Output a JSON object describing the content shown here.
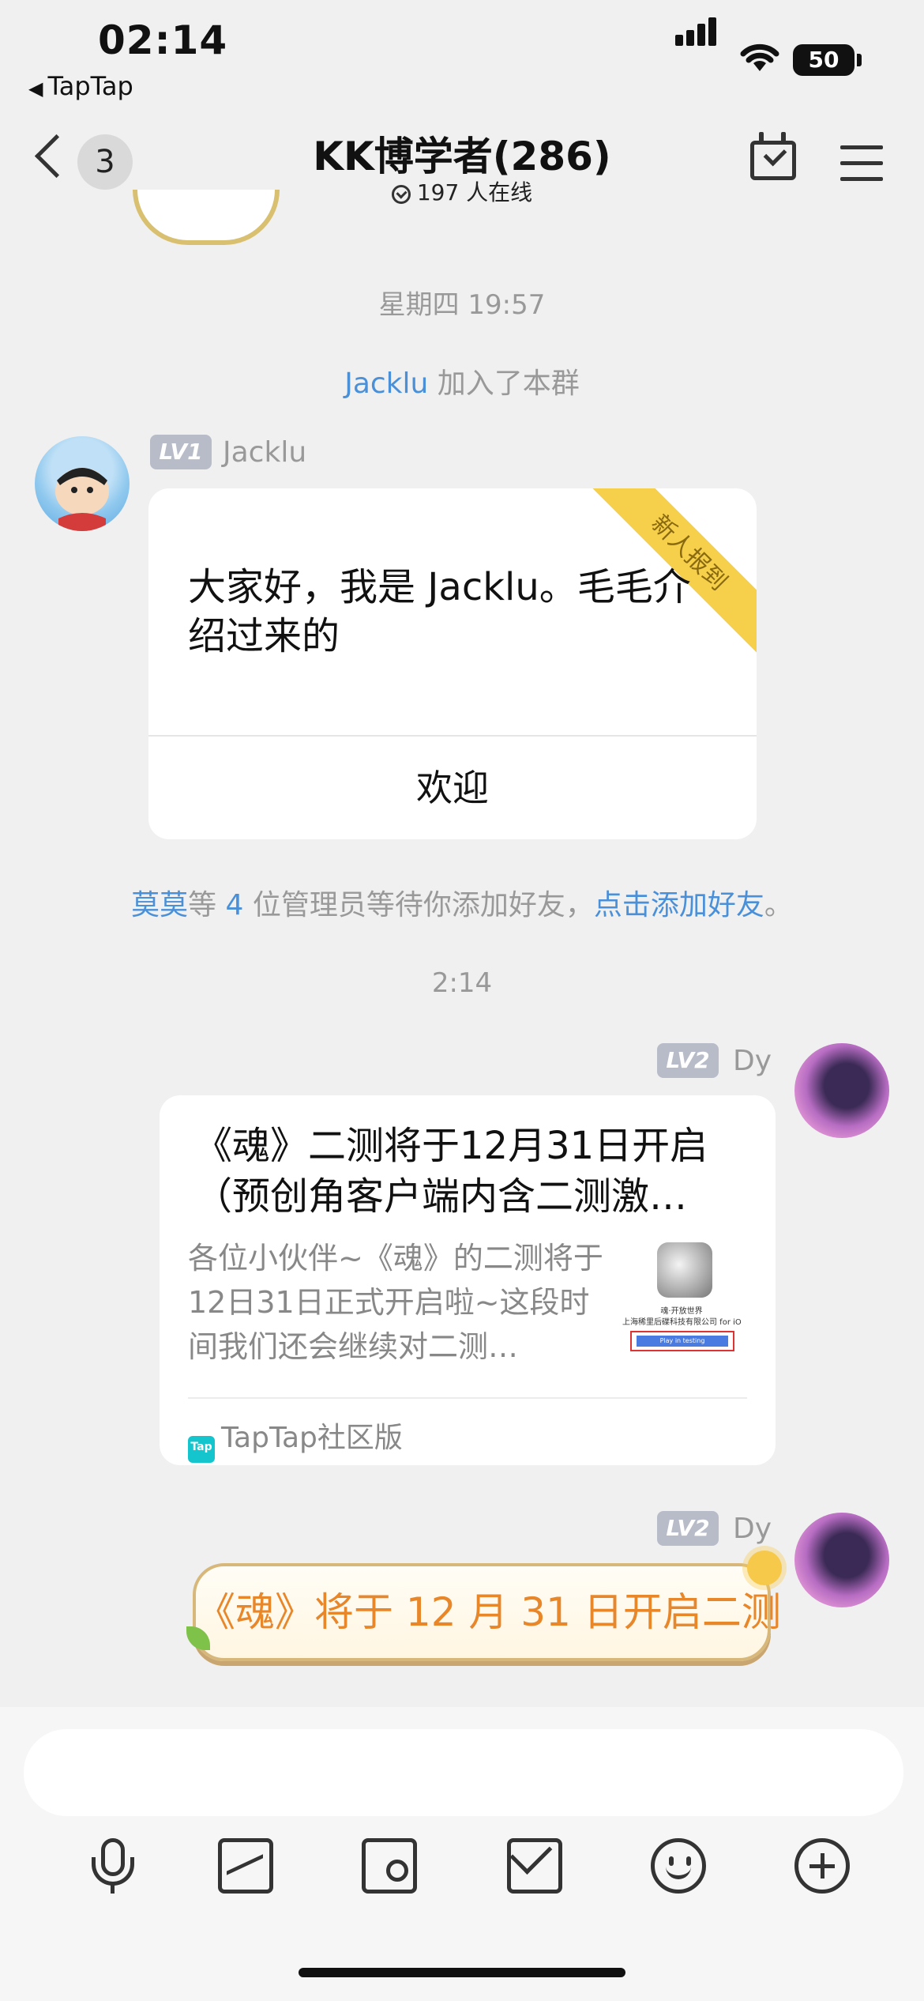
{
  "status_bar": {
    "time": "02:14",
    "back_app": "TapTap",
    "battery": "50"
  },
  "header": {
    "unread_count": "3",
    "title": "KK博学者(286)",
    "online": "197 人在线"
  },
  "chat": {
    "timestamp_1": "星期四 19:57",
    "join_notice": {
      "user": "Jacklu",
      "text": " 加入了本群"
    },
    "welcome_message": {
      "level": "LV1",
      "user": "Jacklu",
      "ribbon": "新人报到",
      "text": "大家好，我是 Jacklu。毛毛介绍过来的",
      "button": "欢迎"
    },
    "admin_notice": {
      "name": "莫莫",
      "part1": "等 ",
      "count": "4",
      "part2": " 位管理员等待你添加好友，",
      "link": "点击添加好友",
      "end": "。"
    },
    "timestamp_2": "2:14",
    "share_message": {
      "level": "LV2",
      "user": "Dy",
      "title": "《魂》二测将于12月31日开启（预创角客户端内含二测激…",
      "desc": "各位小伙伴~《魂》的二测将于12日31日正式开启啦~这段时间我们还会继续对二测…",
      "thumb_line1": "魂·开放世界",
      "thumb_line2": "上海稀里后碟科技有限公司 for iOS",
      "thumb_button": "Play in testing",
      "source": "TapTap社区版",
      "source_logo": "Tap"
    },
    "announcement_message": {
      "level": "LV2",
      "user": "Dy",
      "text": "《魂》将于 12 月 31 日开启二测"
    }
  },
  "input_bar": {
    "placeholder": "",
    "tools": [
      "mic-icon",
      "image-icon",
      "camera-icon",
      "red-envelope-icon",
      "emoji-icon",
      "plus-icon"
    ]
  }
}
